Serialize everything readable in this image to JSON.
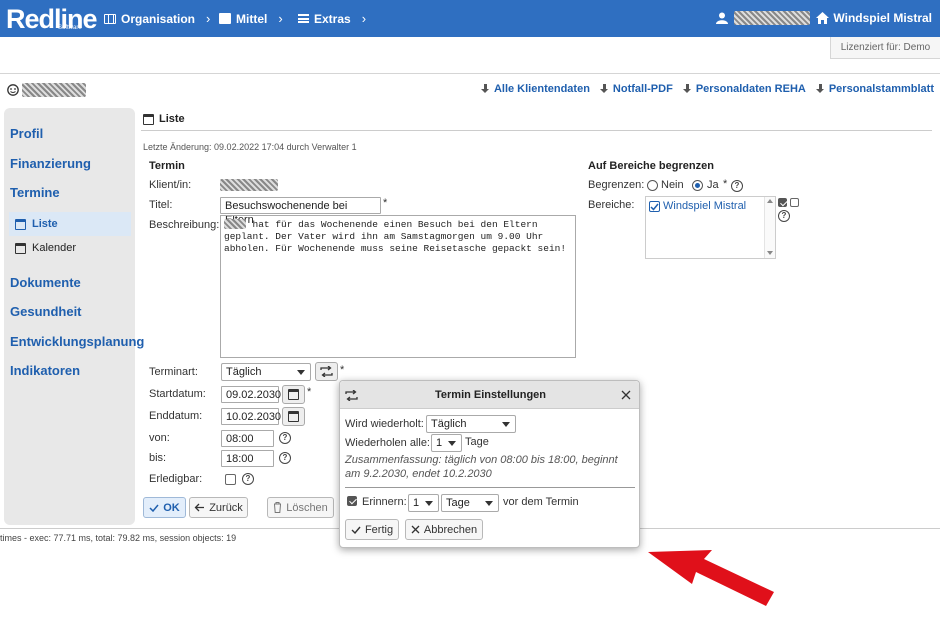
{
  "topbar": {
    "logo": "Redline",
    "logo_sub": "Software",
    "nav": [
      {
        "label": "Organisation",
        "icon": "grid-icon"
      },
      {
        "label": "Mittel",
        "icon": "document-icon"
      },
      {
        "label": "Extras",
        "icon": "menu-icon"
      }
    ],
    "home_label": "Windspiel Mistral"
  },
  "license": "Lizenziert für: Demo",
  "downloads": [
    "Alle Klientendaten",
    "Notfall-PDF",
    "Personaldaten REHA",
    "Personalstammblatt"
  ],
  "sidebar": {
    "items": [
      "Profil",
      "Finanzierung",
      "Termine",
      "Dokumente",
      "Gesundheit",
      "Entwicklungsplanung",
      "Indikatoren"
    ],
    "sub": [
      "Liste",
      "Kalender"
    ]
  },
  "main": {
    "title": "Liste",
    "last_change": "Letzte Änderung: 09.02.2022 17:04 durch Verwalter 1",
    "section_termin": "Termin",
    "labels": {
      "klient": "Klient/in:",
      "titel": "Titel:",
      "beschreibung": "Beschreibung:",
      "terminart": "Terminart:",
      "startdatum": "Startdatum:",
      "enddatum": "Enddatum:",
      "von": "von:",
      "bis": "bis:",
      "erledigbar": "Erledigbar:"
    },
    "values": {
      "titel": "Besuchswochenende bei Eltern",
      "beschreibung": "     hat für das Wochenende einen Besuch bei den Eltern\ngeplant. Der Vater wird ihn am Samstagmorgen um 9.00 Uhr\nabholen. Für Wochenende muss seine Reisetasche gepackt sein!",
      "terminart": "Täglich",
      "startdatum": "09.02.2030",
      "enddatum": "10.02.2030",
      "von": "08:00",
      "bis": "18:00"
    },
    "required": "*",
    "buttons": {
      "ok": "OK",
      "zurueck": "Zurück",
      "loeschen": "Löschen"
    }
  },
  "bereiche": {
    "section": "Auf Bereiche begrenzen",
    "begrenzen_label": "Begrenzen:",
    "nein": "Nein",
    "ja": "Ja",
    "selected": "Ja",
    "bereiche_label": "Bereiche:",
    "items": [
      {
        "label": "Windspiel Mistral",
        "checked": true
      }
    ]
  },
  "dialog": {
    "title": "Termin Einstellungen",
    "wird_label": "Wird wiederholt:",
    "wird_value": "Täglich",
    "alle_label": "Wiederholen alle:",
    "alle_value": "1",
    "alle_unit": "Tage",
    "summary": "Zusammenfassung: täglich von 08:00 bis 18:00, beginnt am 9.2.2030, endet 10.2.2030",
    "erinnern_label": "Erinnern:",
    "erinnern_checked": true,
    "erinnern_value": "1",
    "erinnern_unit": "Tage",
    "erinnern_suffix": "vor dem Termin",
    "fertig": "Fertig",
    "abbrechen": "Abbrechen"
  },
  "footer": {
    "times": "times - exec: 77.71 ms, total: 79.82 ms, session objects: 19"
  },
  "colors": {
    "accent": "#2f6fc1",
    "link": "#1f5fae",
    "arrow": "#e0101a"
  }
}
